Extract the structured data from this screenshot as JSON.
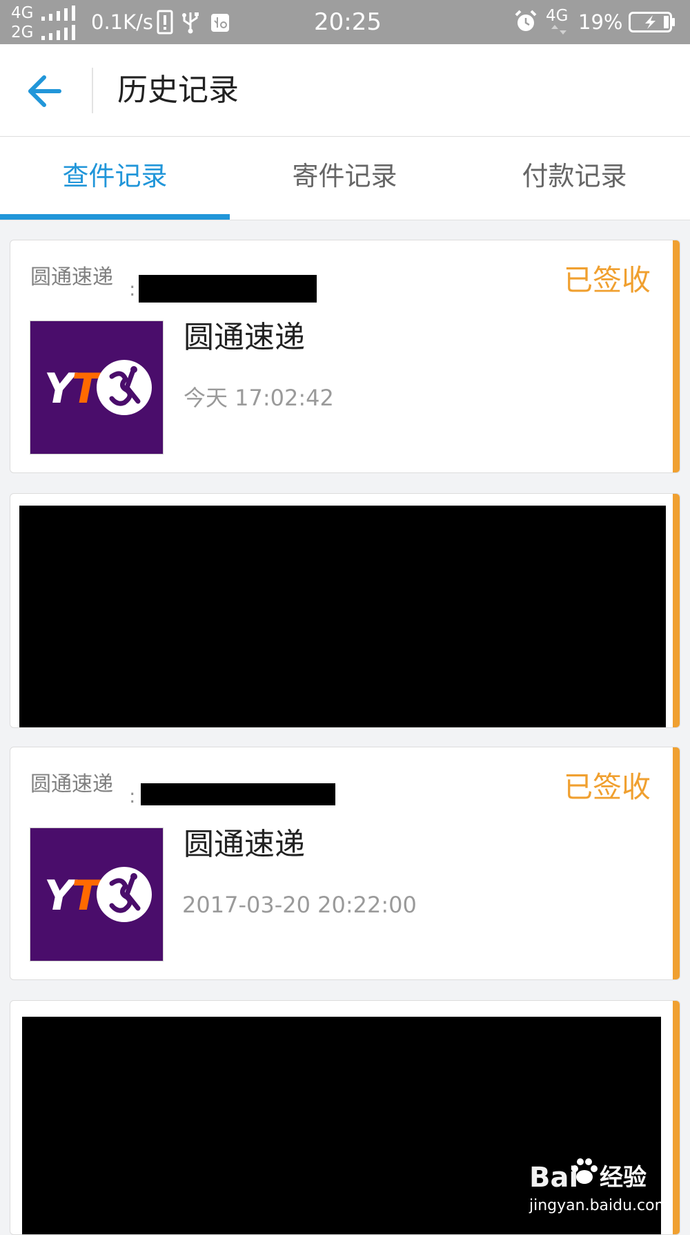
{
  "status_bar": {
    "network_1": "4G",
    "network_2": "2G",
    "net_speed": "0.1K/s",
    "time": "20:25",
    "network_right": "4G",
    "battery": "19%"
  },
  "header": {
    "back_icon": "arrow-left-icon",
    "title": "历史记录"
  },
  "tabs": [
    {
      "label": "查件记录",
      "active": true
    },
    {
      "label": "寄件记录",
      "active": false
    },
    {
      "label": "付款记录",
      "active": false
    }
  ],
  "colors": {
    "accent_blue": "#2196d9",
    "status_orange": "#f0a030",
    "logo_purple": "#4a0d6b",
    "logo_orange": "#ff6a00"
  },
  "records": [
    {
      "carrier_label": "圆通速递",
      "colon": ":",
      "status": "已签收",
      "logo_text": "YT",
      "carrier_name": "圆通速递",
      "time": "今天 17:02:42"
    },
    {
      "carrier_label": "圆通速递",
      "colon": ":",
      "status": "已签收",
      "logo_text": "YT",
      "carrier_name": "圆通速递",
      "time": "2017-03-20 20:22:00"
    }
  ],
  "watermark": {
    "brand": "Bai",
    "cn": "经验",
    "url": "jingyan.baidu.com"
  }
}
